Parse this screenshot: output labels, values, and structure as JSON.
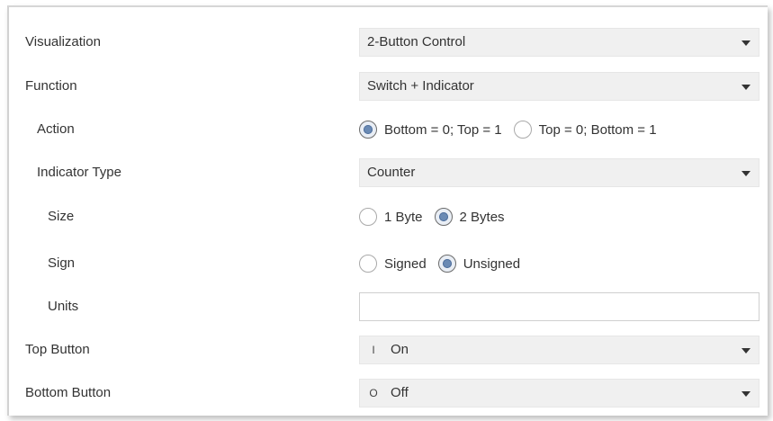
{
  "rows": [
    {
      "label": "Visualization",
      "control": "select",
      "value": "2-Button Control"
    },
    {
      "label": "Function",
      "control": "select",
      "value": "Switch + Indicator"
    },
    {
      "label": "Action",
      "control": "radio",
      "options": [
        {
          "label": "Bottom = 0; Top = 1",
          "selected": true
        },
        {
          "label": "Top = 0; Bottom = 1",
          "selected": false
        }
      ]
    },
    {
      "label": "Indicator Type",
      "control": "select",
      "value": "Counter"
    },
    {
      "label": "Size",
      "control": "radio",
      "options": [
        {
          "label": "1 Byte",
          "selected": false
        },
        {
          "label": "2 Bytes",
          "selected": true
        }
      ]
    },
    {
      "label": "Sign",
      "control": "radio",
      "options": [
        {
          "label": "Signed",
          "selected": false
        },
        {
          "label": "Unsigned",
          "selected": true
        }
      ]
    },
    {
      "label": "Units",
      "control": "text",
      "value": ""
    },
    {
      "label": "Top Button",
      "control": "select",
      "prefix": "I",
      "value": "On"
    },
    {
      "label": "Bottom Button",
      "control": "select",
      "prefix": "O",
      "value": "Off"
    }
  ],
  "colors": {
    "select_background": "#f0f0f0",
    "radio_selected_dot": "#6a8ab4",
    "text": "#333333"
  },
  "icons": {
    "dropdown": "chevron-down-icon",
    "on_symbol": "power-on-icon",
    "off_symbol": "power-off-icon"
  }
}
